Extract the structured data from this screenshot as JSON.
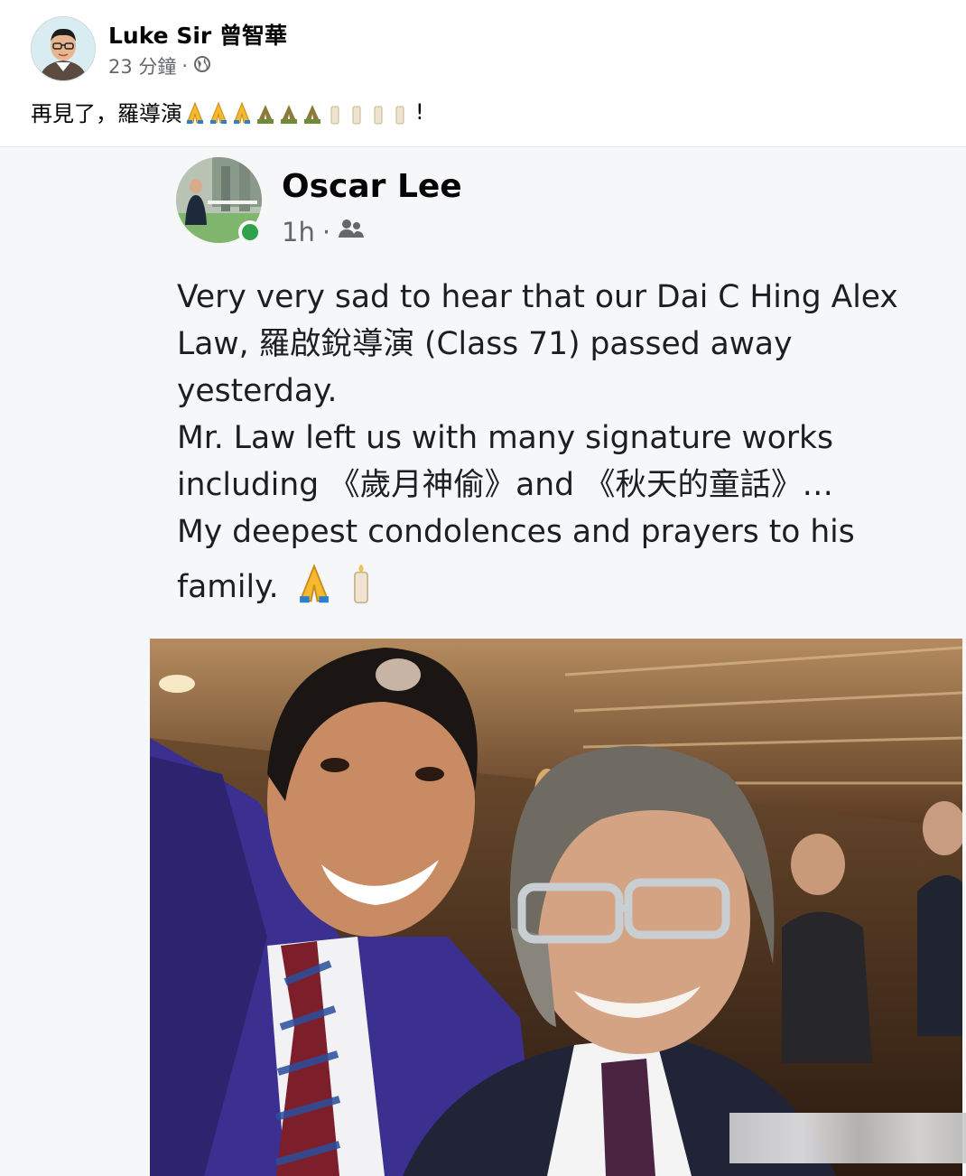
{
  "outer_post": {
    "author": "Luke Sir 曾智華",
    "time": "23 分鐘",
    "separator": "·",
    "text": "再見了，羅導演"
  },
  "shared_post": {
    "author": "Oscar Lee",
    "time": "1h",
    "separator": "·",
    "body_lines": [
      "Very very sad to hear that our Dai C Hing Alex",
      "Law, 羅啟銳導演 (Class 71) passed away",
      "yesterday.",
      "Mr. Law left us with many signature works",
      "including 《歲月神偷》and 《秋天的童話》…",
      "My deepest condolences and prayers to his",
      "family."
    ],
    "online_color": "#31a24c"
  },
  "icons": {
    "privacy": "globe-icon",
    "audience": "friends-icon",
    "emojis": [
      "folded-hands-icon",
      "candle-icon"
    ]
  }
}
